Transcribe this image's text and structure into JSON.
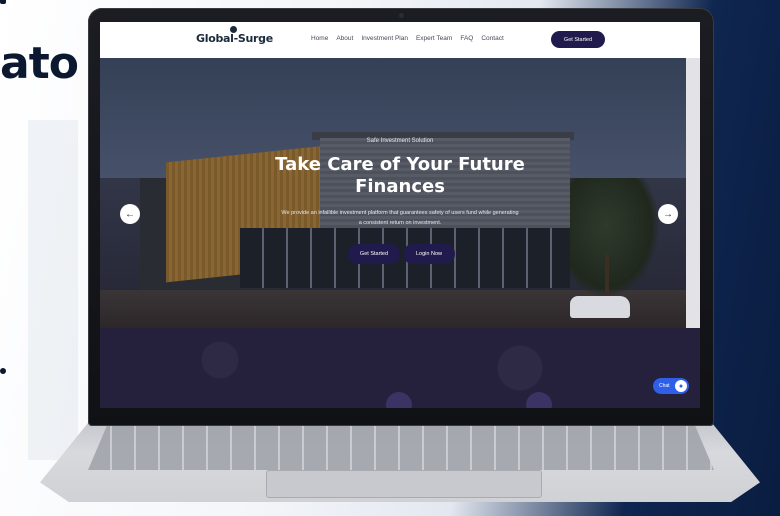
{
  "slide_fragment": {
    "text": "ato"
  },
  "website": {
    "logo": "Global-Surge",
    "nav_links": [
      "Home",
      "About",
      "Investment Plan",
      "Expert Team",
      "FAQ",
      "Contact"
    ],
    "nav_cta": "Get Started",
    "hero": {
      "eyebrow": "Safe Investment Solution",
      "headline": "Take Care of Your Future Finances",
      "subtext": "We provide an infallible investment platform that guarantees safety of users fund while generating a consistent return on investment.",
      "primary_button": "Get Started",
      "secondary_button": "Login Now",
      "prev_arrow": "←",
      "next_arrow": "→"
    },
    "chat_label": "Chat"
  },
  "colors": {
    "button_bg": "#201a4d",
    "nav_bg": "#ffffff",
    "chat_bg": "#2f5fe6"
  }
}
